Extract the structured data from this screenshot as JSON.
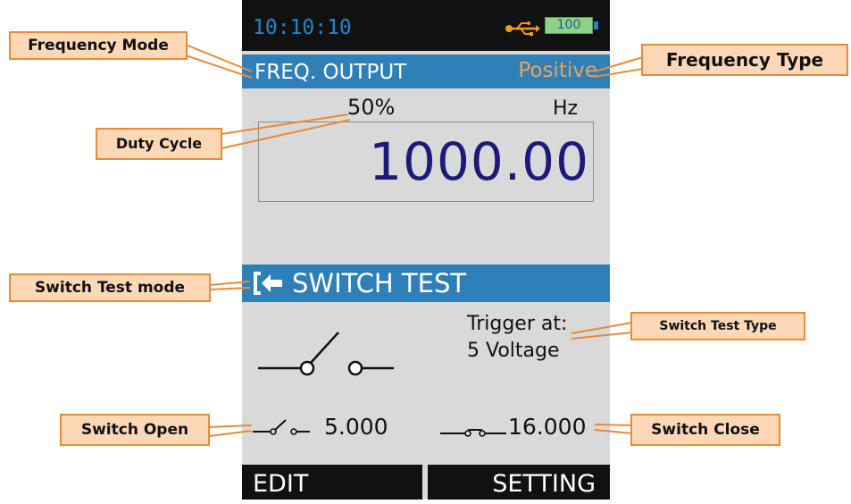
{
  "status": {
    "time": "10:10:10",
    "battery": "100"
  },
  "freq_header": {
    "mode": "FREQ. OUTPUT",
    "type": "Positive"
  },
  "readout": {
    "duty_cycle": "50%",
    "unit": "Hz",
    "value": "1000.00"
  },
  "switch_header": {
    "title": "SWITCH TEST"
  },
  "trigger": {
    "label": "Trigger at:",
    "value": "5 Voltage"
  },
  "switch_values": {
    "open": "5.000",
    "close": "16.000"
  },
  "softkeys": {
    "left": "EDIT",
    "right": "SETTING"
  },
  "callouts": {
    "frequency_mode": "Frequency Mode",
    "frequency_type": "Frequency Type",
    "duty_cycle": "Duty Cycle",
    "switch_test_mode": "Switch Test mode",
    "switch_test_type": "Switch Test Type",
    "switch_open": "Switch Open",
    "switch_close": "Switch Close"
  },
  "icons": [
    "usb-icon",
    "battery-icon",
    "switch-test-icon",
    "open-switch-icon",
    "switch-open-icon",
    "switch-close-icon"
  ],
  "colors": {
    "header_blue": "#2f80b9",
    "screen_bg": "#d9d9d9",
    "value_navy": "#1e1a78",
    "type_orange": "#f0a155",
    "callout_fill": "#fcd8b7",
    "callout_border": "#ea8a37",
    "usb_orange": "#f39c12",
    "battery_green": "#8fd18a"
  }
}
